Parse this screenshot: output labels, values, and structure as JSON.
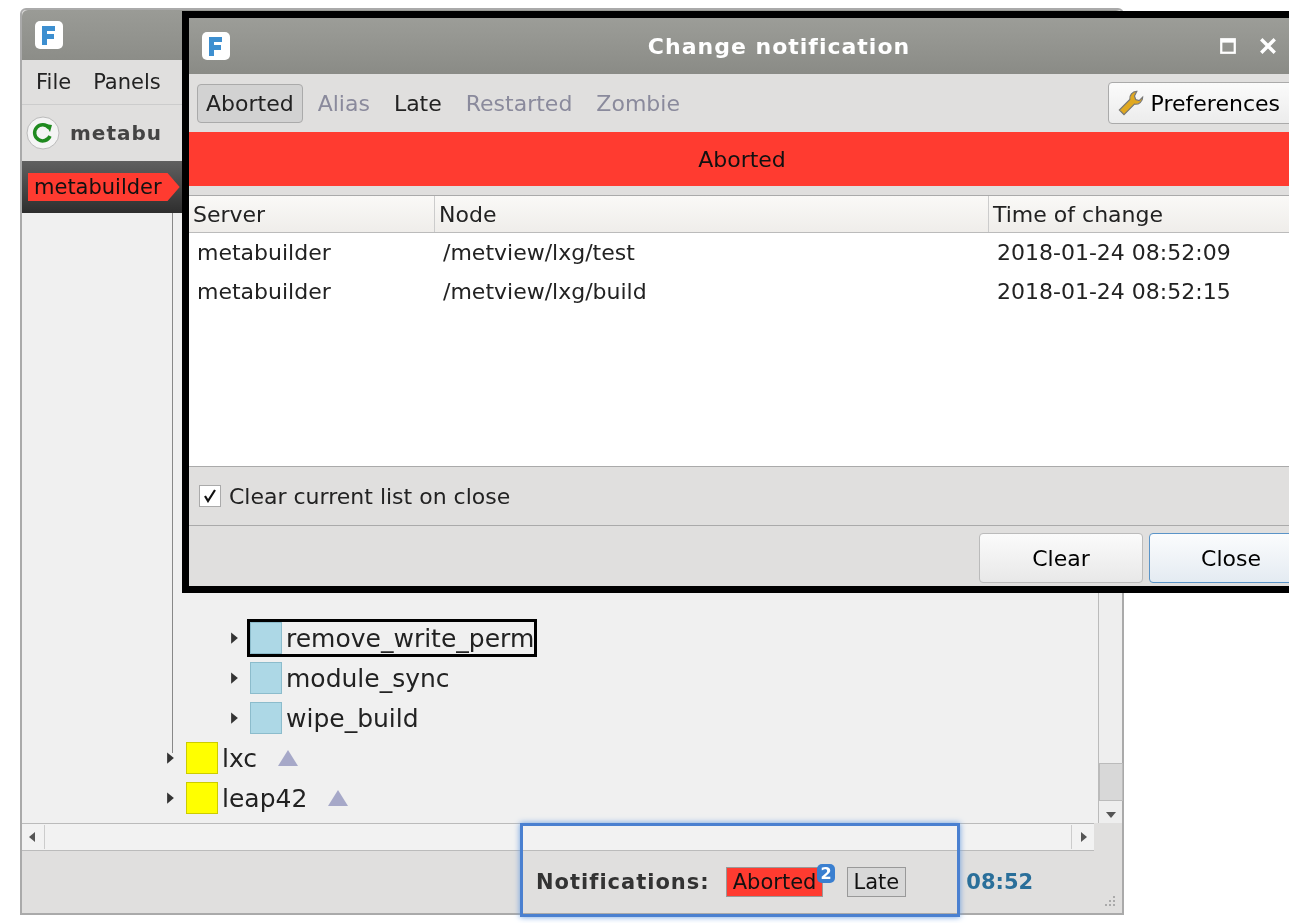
{
  "main_window": {
    "menu": [
      "File",
      "Panels"
    ],
    "toolbar_server": "metabu",
    "server_tab": {
      "label": "metabuilder",
      "color": "#ff3b30"
    },
    "tree": [
      {
        "label": "remove_write_perm",
        "kind": "task",
        "selected": true
      },
      {
        "label": "module_sync",
        "kind": "task",
        "selected": false
      },
      {
        "label": "wipe_build",
        "kind": "task",
        "selected": false
      },
      {
        "label": "lxc",
        "kind": "family",
        "selected": false
      },
      {
        "label": "leap42",
        "kind": "family",
        "selected": false
      }
    ],
    "status_bar": {
      "label": "Notifications:",
      "items": [
        {
          "label": "Aborted",
          "count": "2",
          "color": "#ff3b30"
        },
        {
          "label": "Late",
          "color": "#d8d8d8"
        }
      ],
      "time": "08:52"
    }
  },
  "dialog": {
    "title": "Change notification",
    "filters": [
      {
        "label": "Aborted",
        "selected": true,
        "disabled": false
      },
      {
        "label": "Alias",
        "selected": false,
        "disabled": true
      },
      {
        "label": "Late",
        "selected": false,
        "disabled": false
      },
      {
        "label": "Restarted",
        "selected": false,
        "disabled": true
      },
      {
        "label": "Zombie",
        "selected": false,
        "disabled": true
      }
    ],
    "preferences_button": "Preferences",
    "banner": {
      "label": "Aborted",
      "color": "#ff3b30"
    },
    "table": {
      "columns": [
        "Server",
        "Node",
        "Time of change"
      ],
      "rows": [
        [
          "metabuilder",
          "/metview/lxg/test",
          "2018-01-24 08:52:09"
        ],
        [
          "metabuilder",
          "/metview/lxg/build",
          "2018-01-24 08:52:15"
        ]
      ]
    },
    "clear_on_close": {
      "label": "Clear current list on close",
      "checked": true
    },
    "buttons": [
      {
        "label": "Clear",
        "kind": "normal"
      },
      {
        "label": "Close",
        "kind": "default"
      }
    ]
  }
}
